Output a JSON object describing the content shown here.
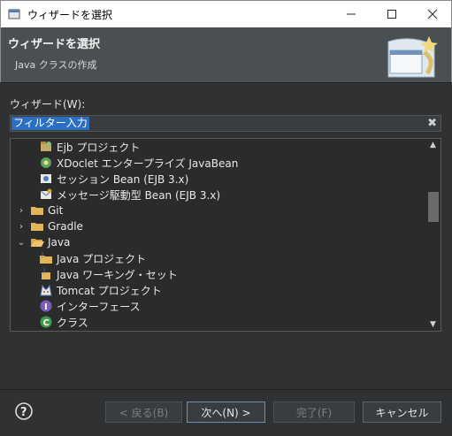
{
  "window": {
    "title": "ウィザードを選択"
  },
  "banner": {
    "heading": "ウィザードを選択",
    "subtitle": "Java クラスの作成"
  },
  "wizard_label": "ウィザード(W):",
  "filter": {
    "value": "フィルター入力"
  },
  "tree": {
    "items": [
      {
        "label": "Ejb プロジェクト",
        "icon": "ejb-project-icon",
        "level": 2
      },
      {
        "label": "XDoclet エンタープライズ JavaBean",
        "icon": "xdoclet-bean-icon",
        "level": 2
      },
      {
        "label": "セッション Bean (EJB 3.x)",
        "icon": "session-bean-icon",
        "level": 2
      },
      {
        "label": "メッセージ駆動型 Bean (EJB 3.x)",
        "icon": "message-bean-icon",
        "level": 2
      },
      {
        "label": "Git",
        "icon": "folder-icon",
        "level": 1,
        "expanded": false
      },
      {
        "label": "Gradle",
        "icon": "folder-icon",
        "level": 1,
        "expanded": false
      },
      {
        "label": "Java",
        "icon": "folder-open-icon",
        "level": 1,
        "expanded": true
      },
      {
        "label": "Java プロジェクト",
        "icon": "java-project-icon",
        "level": 2
      },
      {
        "label": "Java ワーキング・セット",
        "icon": "working-set-icon",
        "level": 2
      },
      {
        "label": "Tomcat プロジェクト",
        "icon": "tomcat-icon",
        "level": 2
      },
      {
        "label": "インターフェース",
        "icon": "interface-icon",
        "level": 2
      },
      {
        "label": "クラス",
        "icon": "class-icon",
        "level": 2
      }
    ]
  },
  "buttons": {
    "back": "< 戻る(B)",
    "next": "次へ(N) >",
    "finish": "完了(F)",
    "cancel": "キャンセル"
  },
  "colors": {
    "accent": "#2b6fc2",
    "dialog_bg": "#2f3133",
    "banner_bg": "#4a5052"
  }
}
